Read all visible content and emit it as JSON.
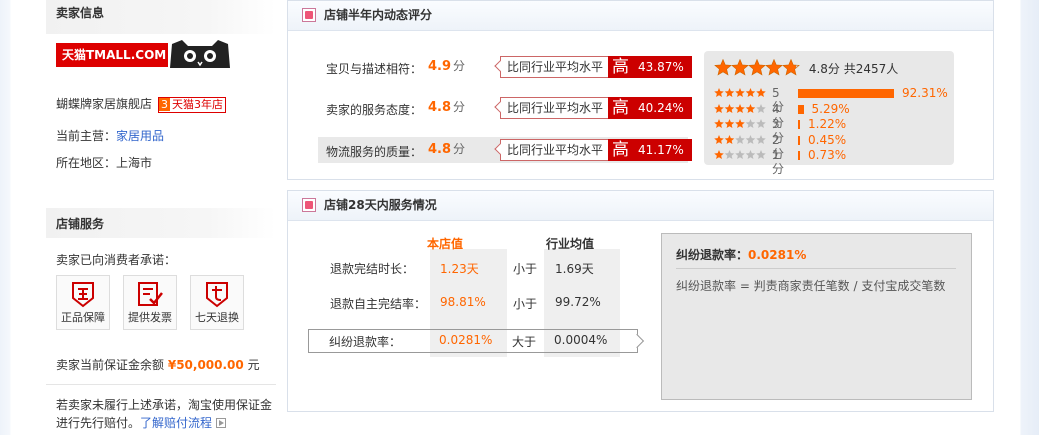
{
  "seller": {
    "section_title": "卖家信息",
    "logo_text": "天猫TMALL.COM",
    "shop_name": "蝴蝶牌家居旗舰店",
    "shop_badge_num": "3",
    "shop_badge_text": "天猫3年店",
    "category_label": "当前主营：",
    "category_value": "家居用品",
    "location_label": "所在地区：",
    "location_value": "上海市"
  },
  "service": {
    "section_title": "店铺服务",
    "promise_text": "卖家已向消费者承诺：",
    "badges": [
      {
        "icon": "genuine-icon",
        "label": "正品保障"
      },
      {
        "icon": "invoice-icon",
        "label": "提供发票"
      },
      {
        "icon": "seven-day-return-icon",
        "label": "七天退换"
      }
    ],
    "deposit_label": "卖家当前保证金余额",
    "deposit_amount": "¥50,000.00",
    "deposit_unit": "元",
    "notice_text": "若卖家未履行上述承诺，淘宝使用保证金进行先行赔付。",
    "notice_link": "了解赔付流程"
  },
  "rating_panel": {
    "title": "店铺半年内动态评分",
    "compare_label": "比同行业平均水平",
    "high_glyph": "高",
    "score_unit": "分",
    "rows": [
      {
        "name": "宝贝与描述相符：",
        "score": "4.9",
        "percent": "43.87%"
      },
      {
        "name": "卖家的服务态度：",
        "score": "4.8",
        "percent": "40.24%"
      },
      {
        "name": "物流服务的质量：",
        "score": "4.8",
        "percent": "41.17%"
      }
    ],
    "summary_score": "4.8分",
    "summary_count": "共2457人",
    "summary_stars": 4.8,
    "distribution": [
      {
        "label": "5分",
        "stars": 5,
        "value": 92.31,
        "percent": "92.31%"
      },
      {
        "label": "4分",
        "stars": 4,
        "value": 5.29,
        "percent": "5.29%"
      },
      {
        "label": "3分",
        "stars": 3,
        "value": 1.22,
        "percent": "1.22%"
      },
      {
        "label": "2分",
        "stars": 2,
        "value": 0.45,
        "percent": "0.45%"
      },
      {
        "label": "1分",
        "stars": 1,
        "value": 0.73,
        "percent": "0.73%"
      }
    ],
    "colors": {
      "accent": "#ff6600",
      "high_bg": "#cc0000"
    }
  },
  "service_panel": {
    "title": "店铺28天内服务情况",
    "col_shop": "本店值",
    "col_industry": "行业均值",
    "rows": [
      {
        "label": "退款完结时长：",
        "shop": "1.23天",
        "cmp": "小于",
        "industry": "1.69天"
      },
      {
        "label": "退款自主完结率：",
        "shop": "98.81%",
        "cmp": "小于",
        "industry": "99.72%"
      },
      {
        "label": "纠纷退款率：",
        "shop": "0.0281%",
        "cmp": "大于",
        "industry": "0.0004%"
      }
    ],
    "detail_title": "纠纷退款率：",
    "detail_value": "0.0281%",
    "detail_formula": "纠纷退款率 = 判责商家责任笔数 / 支付宝成交笔数"
  }
}
